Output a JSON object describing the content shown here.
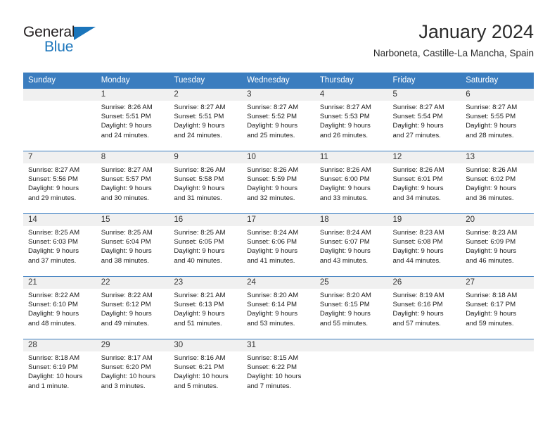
{
  "brand": {
    "name_part1": "General",
    "name_part2": "Blue",
    "accent_color": "#1b75bb",
    "triangle_icon": "triangle-icon"
  },
  "header": {
    "title": "January 2024",
    "subtitle": "Narboneta, Castille-La Mancha, Spain"
  },
  "calendar": {
    "header_bg": "#3b7dbf",
    "daynum_bg": "#f0f0f0",
    "weekday_headers": [
      "Sunday",
      "Monday",
      "Tuesday",
      "Wednesday",
      "Thursday",
      "Friday",
      "Saturday"
    ],
    "weeks": [
      [
        {
          "day": "",
          "sunrise": "",
          "sunset": "",
          "daylight_line1": "",
          "daylight_line2": ""
        },
        {
          "day": "1",
          "sunrise": "Sunrise: 8:26 AM",
          "sunset": "Sunset: 5:51 PM",
          "daylight_line1": "Daylight: 9 hours",
          "daylight_line2": "and 24 minutes."
        },
        {
          "day": "2",
          "sunrise": "Sunrise: 8:27 AM",
          "sunset": "Sunset: 5:51 PM",
          "daylight_line1": "Daylight: 9 hours",
          "daylight_line2": "and 24 minutes."
        },
        {
          "day": "3",
          "sunrise": "Sunrise: 8:27 AM",
          "sunset": "Sunset: 5:52 PM",
          "daylight_line1": "Daylight: 9 hours",
          "daylight_line2": "and 25 minutes."
        },
        {
          "day": "4",
          "sunrise": "Sunrise: 8:27 AM",
          "sunset": "Sunset: 5:53 PM",
          "daylight_line1": "Daylight: 9 hours",
          "daylight_line2": "and 26 minutes."
        },
        {
          "day": "5",
          "sunrise": "Sunrise: 8:27 AM",
          "sunset": "Sunset: 5:54 PM",
          "daylight_line1": "Daylight: 9 hours",
          "daylight_line2": "and 27 minutes."
        },
        {
          "day": "6",
          "sunrise": "Sunrise: 8:27 AM",
          "sunset": "Sunset: 5:55 PM",
          "daylight_line1": "Daylight: 9 hours",
          "daylight_line2": "and 28 minutes."
        }
      ],
      [
        {
          "day": "7",
          "sunrise": "Sunrise: 8:27 AM",
          "sunset": "Sunset: 5:56 PM",
          "daylight_line1": "Daylight: 9 hours",
          "daylight_line2": "and 29 minutes."
        },
        {
          "day": "8",
          "sunrise": "Sunrise: 8:27 AM",
          "sunset": "Sunset: 5:57 PM",
          "daylight_line1": "Daylight: 9 hours",
          "daylight_line2": "and 30 minutes."
        },
        {
          "day": "9",
          "sunrise": "Sunrise: 8:26 AM",
          "sunset": "Sunset: 5:58 PM",
          "daylight_line1": "Daylight: 9 hours",
          "daylight_line2": "and 31 minutes."
        },
        {
          "day": "10",
          "sunrise": "Sunrise: 8:26 AM",
          "sunset": "Sunset: 5:59 PM",
          "daylight_line1": "Daylight: 9 hours",
          "daylight_line2": "and 32 minutes."
        },
        {
          "day": "11",
          "sunrise": "Sunrise: 8:26 AM",
          "sunset": "Sunset: 6:00 PM",
          "daylight_line1": "Daylight: 9 hours",
          "daylight_line2": "and 33 minutes."
        },
        {
          "day": "12",
          "sunrise": "Sunrise: 8:26 AM",
          "sunset": "Sunset: 6:01 PM",
          "daylight_line1": "Daylight: 9 hours",
          "daylight_line2": "and 34 minutes."
        },
        {
          "day": "13",
          "sunrise": "Sunrise: 8:26 AM",
          "sunset": "Sunset: 6:02 PM",
          "daylight_line1": "Daylight: 9 hours",
          "daylight_line2": "and 36 minutes."
        }
      ],
      [
        {
          "day": "14",
          "sunrise": "Sunrise: 8:25 AM",
          "sunset": "Sunset: 6:03 PM",
          "daylight_line1": "Daylight: 9 hours",
          "daylight_line2": "and 37 minutes."
        },
        {
          "day": "15",
          "sunrise": "Sunrise: 8:25 AM",
          "sunset": "Sunset: 6:04 PM",
          "daylight_line1": "Daylight: 9 hours",
          "daylight_line2": "and 38 minutes."
        },
        {
          "day": "16",
          "sunrise": "Sunrise: 8:25 AM",
          "sunset": "Sunset: 6:05 PM",
          "daylight_line1": "Daylight: 9 hours",
          "daylight_line2": "and 40 minutes."
        },
        {
          "day": "17",
          "sunrise": "Sunrise: 8:24 AM",
          "sunset": "Sunset: 6:06 PM",
          "daylight_line1": "Daylight: 9 hours",
          "daylight_line2": "and 41 minutes."
        },
        {
          "day": "18",
          "sunrise": "Sunrise: 8:24 AM",
          "sunset": "Sunset: 6:07 PM",
          "daylight_line1": "Daylight: 9 hours",
          "daylight_line2": "and 43 minutes."
        },
        {
          "day": "19",
          "sunrise": "Sunrise: 8:23 AM",
          "sunset": "Sunset: 6:08 PM",
          "daylight_line1": "Daylight: 9 hours",
          "daylight_line2": "and 44 minutes."
        },
        {
          "day": "20",
          "sunrise": "Sunrise: 8:23 AM",
          "sunset": "Sunset: 6:09 PM",
          "daylight_line1": "Daylight: 9 hours",
          "daylight_line2": "and 46 minutes."
        }
      ],
      [
        {
          "day": "21",
          "sunrise": "Sunrise: 8:22 AM",
          "sunset": "Sunset: 6:10 PM",
          "daylight_line1": "Daylight: 9 hours",
          "daylight_line2": "and 48 minutes."
        },
        {
          "day": "22",
          "sunrise": "Sunrise: 8:22 AM",
          "sunset": "Sunset: 6:12 PM",
          "daylight_line1": "Daylight: 9 hours",
          "daylight_line2": "and 49 minutes."
        },
        {
          "day": "23",
          "sunrise": "Sunrise: 8:21 AM",
          "sunset": "Sunset: 6:13 PM",
          "daylight_line1": "Daylight: 9 hours",
          "daylight_line2": "and 51 minutes."
        },
        {
          "day": "24",
          "sunrise": "Sunrise: 8:20 AM",
          "sunset": "Sunset: 6:14 PM",
          "daylight_line1": "Daylight: 9 hours",
          "daylight_line2": "and 53 minutes."
        },
        {
          "day": "25",
          "sunrise": "Sunrise: 8:20 AM",
          "sunset": "Sunset: 6:15 PM",
          "daylight_line1": "Daylight: 9 hours",
          "daylight_line2": "and 55 minutes."
        },
        {
          "day": "26",
          "sunrise": "Sunrise: 8:19 AM",
          "sunset": "Sunset: 6:16 PM",
          "daylight_line1": "Daylight: 9 hours",
          "daylight_line2": "and 57 minutes."
        },
        {
          "day": "27",
          "sunrise": "Sunrise: 8:18 AM",
          "sunset": "Sunset: 6:17 PM",
          "daylight_line1": "Daylight: 9 hours",
          "daylight_line2": "and 59 minutes."
        }
      ],
      [
        {
          "day": "28",
          "sunrise": "Sunrise: 8:18 AM",
          "sunset": "Sunset: 6:19 PM",
          "daylight_line1": "Daylight: 10 hours",
          "daylight_line2": "and 1 minute."
        },
        {
          "day": "29",
          "sunrise": "Sunrise: 8:17 AM",
          "sunset": "Sunset: 6:20 PM",
          "daylight_line1": "Daylight: 10 hours",
          "daylight_line2": "and 3 minutes."
        },
        {
          "day": "30",
          "sunrise": "Sunrise: 8:16 AM",
          "sunset": "Sunset: 6:21 PM",
          "daylight_line1": "Daylight: 10 hours",
          "daylight_line2": "and 5 minutes."
        },
        {
          "day": "31",
          "sunrise": "Sunrise: 8:15 AM",
          "sunset": "Sunset: 6:22 PM",
          "daylight_line1": "Daylight: 10 hours",
          "daylight_line2": "and 7 minutes."
        },
        {
          "day": "",
          "sunrise": "",
          "sunset": "",
          "daylight_line1": "",
          "daylight_line2": ""
        },
        {
          "day": "",
          "sunrise": "",
          "sunset": "",
          "daylight_line1": "",
          "daylight_line2": ""
        },
        {
          "day": "",
          "sunrise": "",
          "sunset": "",
          "daylight_line1": "",
          "daylight_line2": ""
        }
      ]
    ]
  }
}
